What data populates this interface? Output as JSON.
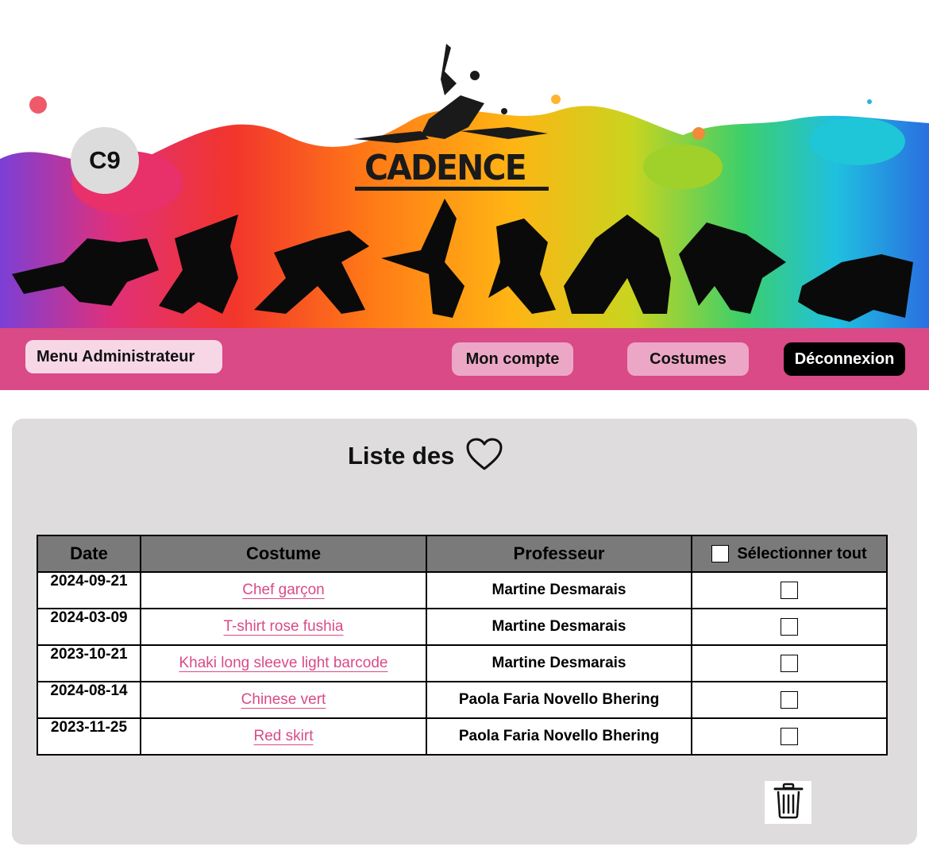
{
  "header": {
    "badge_text": "C9",
    "logo_text": "CADENCE",
    "logo_name": "cadence-dancer-logo"
  },
  "nav": {
    "admin_label": "Menu Administrateur",
    "account_label": "Mon compte",
    "costumes_label": "Costumes",
    "logout_label": "Déconnexion"
  },
  "main": {
    "title": "Liste des",
    "title_icon": "heart-icon",
    "table": {
      "headers": [
        "Date",
        "Costume",
        "Professeur",
        "Sélectionner tout"
      ],
      "rows": [
        {
          "date": "2024-09-21",
          "costume": "Chef garçon",
          "professeur": "Martine Desmarais"
        },
        {
          "date": "2024-03-09",
          "costume": "T-shirt rose fushia",
          "professeur": "Martine Desmarais"
        },
        {
          "date": "2023-10-21",
          "costume": "Khaki long sleeve light barcode",
          "professeur": "Martine Desmarais"
        },
        {
          "date": "2024-08-14",
          "costume": "Chinese vert",
          "professeur": "Paola Faria Novello Bhering"
        },
        {
          "date": "2023-11-25",
          "costume": "Red skirt",
          "professeur": "Paola Faria Novello Bhering"
        }
      ]
    },
    "delete_icon": "trash-icon"
  },
  "colors": {
    "accent": "#d94a87",
    "nav_button": "#eca7c6",
    "admin_button": "#f7d7e6",
    "panel": "#dedcdd",
    "table_header": "#7a7a7a"
  }
}
